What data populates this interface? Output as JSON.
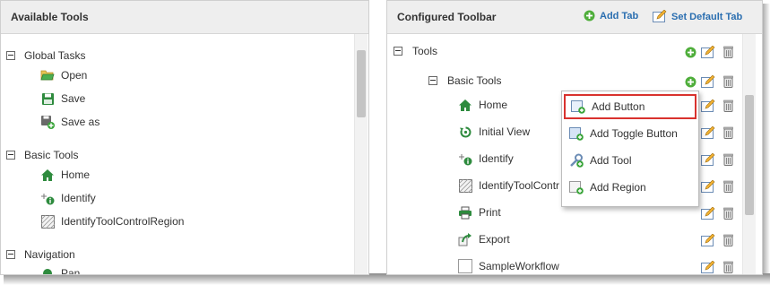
{
  "left_panel": {
    "title": "Available Tools",
    "groups": [
      {
        "label": "Global Tasks",
        "items": [
          {
            "label": "Open",
            "icon": "folder-open-icon"
          },
          {
            "label": "Save",
            "icon": "save-icon"
          },
          {
            "label": "Save as",
            "icon": "save-as-icon"
          }
        ]
      },
      {
        "label": "Basic Tools",
        "items": [
          {
            "label": "Home",
            "icon": "home-icon"
          },
          {
            "label": "Identify",
            "icon": "identify-icon"
          },
          {
            "label": "IdentifyToolControlRegion",
            "icon": "region-icon"
          }
        ]
      },
      {
        "label": "Navigation",
        "items": [
          {
            "label": "Pan",
            "icon": "pan-icon"
          }
        ]
      }
    ]
  },
  "right_panel": {
    "title": "Configured Toolbar",
    "add_tab_label": "Add Tab",
    "set_default_tab_label": "Set Default Tab",
    "root_label": "Tools",
    "group_label": "Basic Tools",
    "items": [
      {
        "label": "Home",
        "icon": "home-icon"
      },
      {
        "label": "Initial View",
        "icon": "initial-view-icon"
      },
      {
        "label": "Identify",
        "icon": "identify-icon"
      },
      {
        "label": "IdentifyToolContr",
        "icon": "region-icon"
      },
      {
        "label": "Print",
        "icon": "print-icon"
      },
      {
        "label": "Export",
        "icon": "export-icon"
      },
      {
        "label": "SampleWorkflow",
        "icon": "workflow-icon"
      }
    ]
  },
  "context_menu": {
    "items": [
      {
        "label": "Add Button",
        "highlighted": true
      },
      {
        "label": "Add Toggle Button",
        "highlighted": false
      },
      {
        "label": "Add Tool",
        "highlighted": false
      },
      {
        "label": "Add Region",
        "highlighted": false
      }
    ]
  },
  "colors": {
    "link_blue": "#2a6eb0",
    "highlight_red": "#d9322e",
    "add_green": "#4fae3b",
    "header_gray": "#eeeeee"
  }
}
